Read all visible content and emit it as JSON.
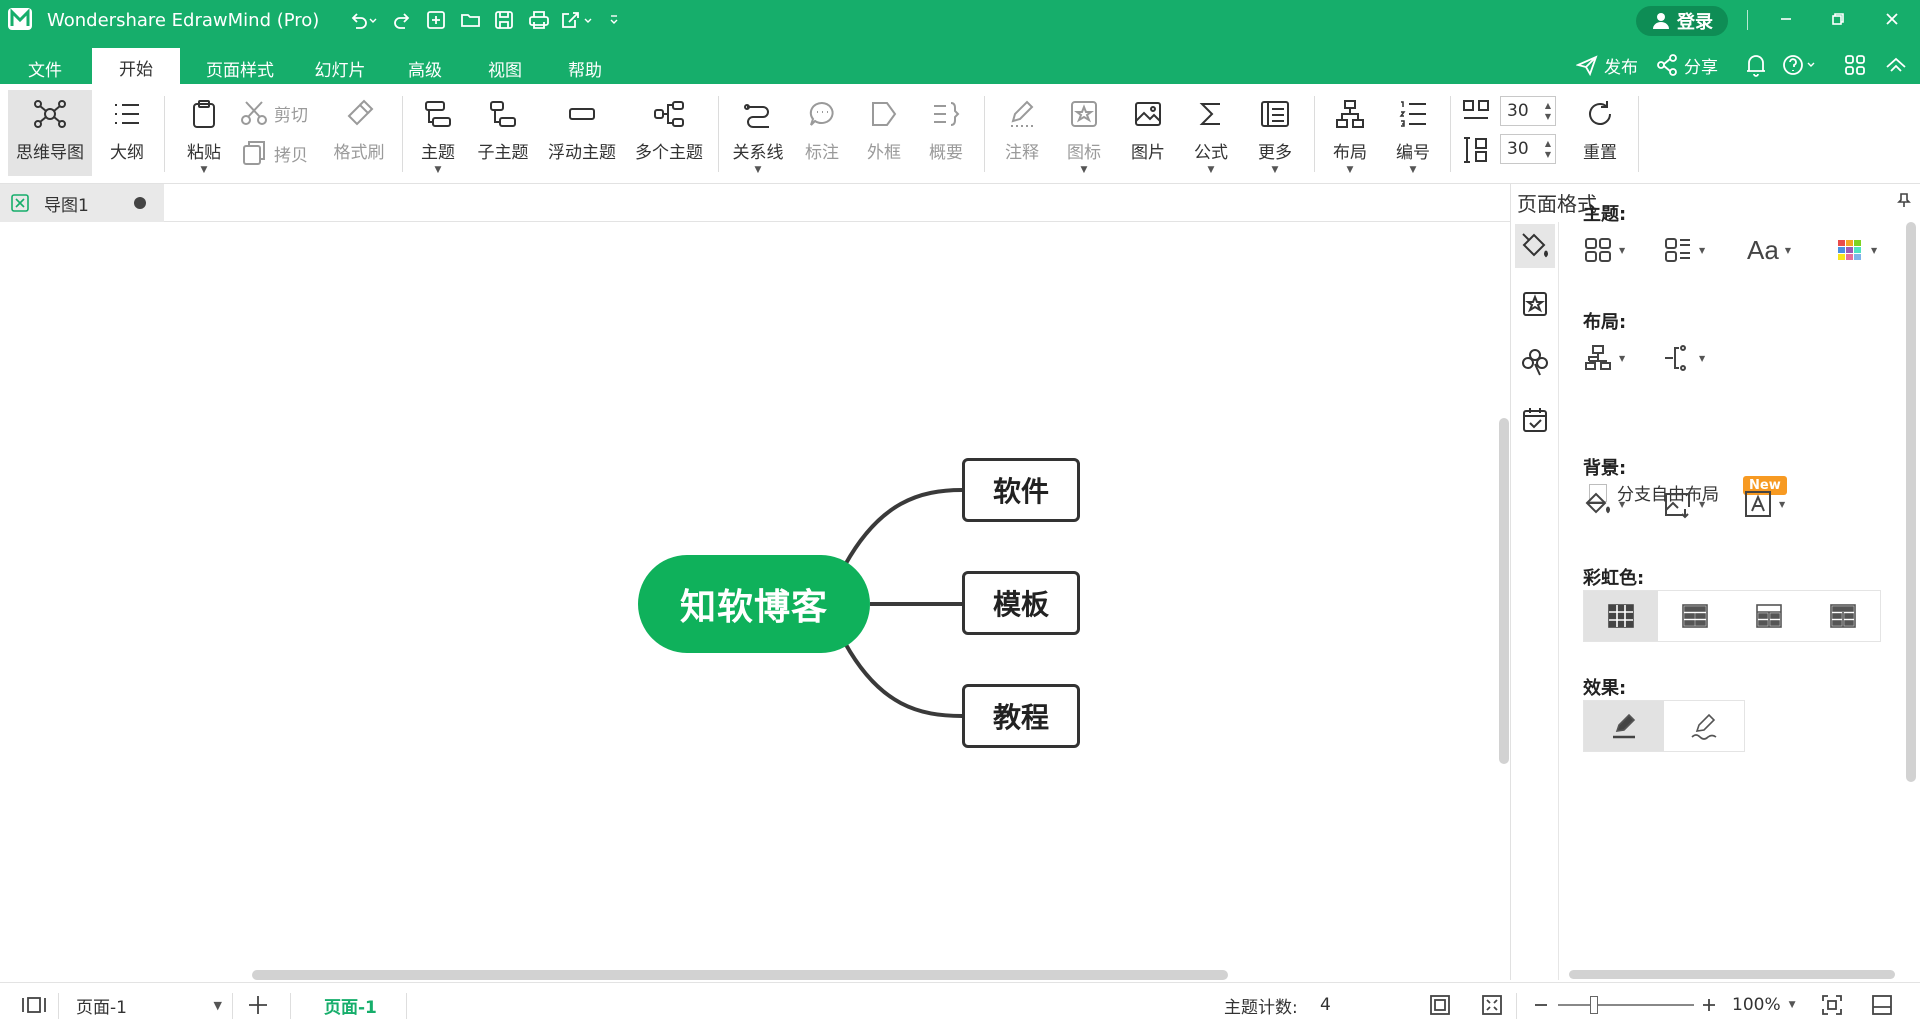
{
  "app": {
    "title": "Wondershare EdrawMind (Pro)",
    "login_label": "登录"
  },
  "menu": {
    "tabs": [
      "文件",
      "开始",
      "页面样式",
      "幻灯片",
      "高级",
      "视图",
      "帮助"
    ],
    "active_tab": "开始",
    "publish_label": "发布",
    "share_label": "分享"
  },
  "ribbon": {
    "mindmap": "思维导图",
    "outline": "大纲",
    "paste": "粘贴",
    "cut": "剪切",
    "copy": "拷贝",
    "format_painter": "格式刷",
    "topic": "主题",
    "subtopic": "子主题",
    "floating_topic": "浮动主题",
    "multiple_topics": "多个主题",
    "relationship": "关系线",
    "callout": "标注",
    "boundary": "外框",
    "summary": "概要",
    "note": "注释",
    "icon": "图标",
    "picture": "图片",
    "formula": "公式",
    "more": "更多",
    "layout": "布局",
    "numbering": "编号",
    "h_spacing": "30",
    "v_spacing": "30",
    "reset": "重置"
  },
  "document": {
    "tab_name": "导图1"
  },
  "mindmap": {
    "central_topic": "知软博客",
    "subtopics": [
      "软件",
      "模板",
      "教程"
    ],
    "central_color": "#0fb15b"
  },
  "panel": {
    "title": "页面格式",
    "theme_label": "主题:",
    "layout_label": "布局:",
    "free_layout_label": "分支自由布局",
    "new_badge": "New",
    "free_layout_checked": false,
    "background_label": "背景:",
    "rainbow_label": "彩虹色:",
    "effect_label": "效果:"
  },
  "status": {
    "page_select": "页面-1",
    "active_page": "页面-1",
    "topic_count_label": "主题计数:",
    "topic_count": "4",
    "zoom": "100%"
  },
  "colors": {
    "brand": "#16ae6b",
    "central_topic": "#0fb15b",
    "new_badge": "#f79a22"
  }
}
